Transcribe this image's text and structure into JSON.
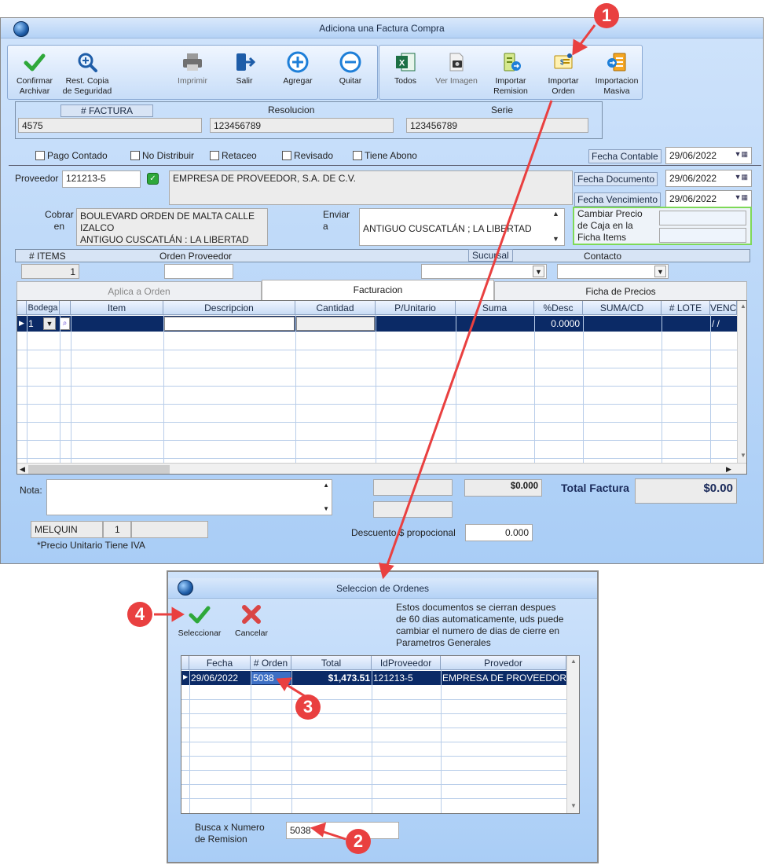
{
  "main_window": {
    "title": "Adiciona una Factura Compra",
    "toolbar": [
      {
        "name": "confirmar",
        "label1": "Confirmar",
        "label2": "Archivar",
        "icon": "check-icon"
      },
      {
        "name": "rest-copia",
        "label1": "Rest. Copia",
        "label2": "de Seguridad",
        "icon": "magnifier-icon"
      },
      {
        "name": "imprimir",
        "label1": "Imprimir",
        "label2": "",
        "icon": "printer-icon"
      },
      {
        "name": "salir",
        "label1": "Salir",
        "label2": "",
        "icon": "exit-icon"
      },
      {
        "name": "agregar",
        "label1": "Agregar",
        "label2": "",
        "icon": "plus-icon"
      },
      {
        "name": "quitar",
        "label1": "Quitar",
        "label2": "",
        "icon": "minus-icon"
      },
      {
        "name": "todos",
        "label1": "Todos",
        "label2": "",
        "icon": "excel-icon"
      },
      {
        "name": "ver-imagen",
        "label1": "Ver Imagen",
        "label2": "",
        "icon": "camera-icon"
      },
      {
        "name": "importar-remision",
        "label1": "Importar",
        "label2": "Remision",
        "icon": "import-remision-icon"
      },
      {
        "name": "importar-orden",
        "label1": "Importar",
        "label2": "Orden",
        "icon": "import-orden-icon"
      },
      {
        "name": "importacion-masiva",
        "label1": "Importacion",
        "label2": "Masiva",
        "icon": "import-masiva-icon"
      }
    ],
    "factura_label": "# FACTURA",
    "factura_value": "4575",
    "resolucion_label": "Resolucion",
    "resolucion_value": "123456789",
    "serie_label": "Serie",
    "serie_value": "123456789",
    "checks": [
      "Pago Contado",
      "No Distribuir",
      "Retaceo",
      "Revisado",
      "Tiene Abono"
    ],
    "fecha_contable_label": "Fecha Contable",
    "fecha_contable": "29/06/2022",
    "proveedor_label": "Proveedor",
    "proveedor_code": "121213-5",
    "proveedor_name": "EMPRESA DE PROVEEDOR, S.A. DE C.V.",
    "fecha_documento_label": "Fecha Documento",
    "fecha_documento": "29/06/2022",
    "fecha_vencimiento_label": "Fecha Vencimiento",
    "fecha_vencimiento": "29/06/2022",
    "cobrar_label1": "Cobrar",
    "cobrar_label2": "en",
    "cobrar_line1": "BOULEVARD ORDEN DE MALTA CALLE",
    "cobrar_line2": "IZALCO",
    "cobrar_line3": "ANTIGUO CUSCATLÁN : LA LIBERTAD",
    "enviar_label1": "Enviar",
    "enviar_label2": "a",
    "enviar_value": "ANTIGUO CUSCATLÁN ; LA LIBERTAD",
    "cambiar_line1": "Cambiar Precio",
    "cambiar_line2": "de Caja en la",
    "cambiar_line3": "Ficha Items",
    "items_label": "# ITEMS",
    "items_value": "1",
    "orden_proveedor_label": "Orden Proveedor",
    "sucursal_label": "Sucursal",
    "contacto_label": "Contacto",
    "tabs": [
      "Aplica a Orden",
      "Facturacion",
      "Ficha de Precios"
    ],
    "grid_headers": [
      "Bodega",
      "Item",
      "Descripcion",
      "Cantidad",
      "P/Unitario",
      "Suma",
      "%Desc",
      "SUMA/CD",
      "# LOTE",
      "VENC"
    ],
    "grid_row": {
      "bodega": "1",
      "desc_pct": "0.0000",
      "venc": "/ /"
    },
    "nota_label": "Nota:",
    "subtotal": "$0.000",
    "total_factura_label": "Total Factura",
    "total_factura": "$0.00",
    "user": "MELQUIN",
    "user_num": "1",
    "precio_note": "*Precio Unitario Tiene IVA",
    "descuento_label": "Descuento $ propocional",
    "descuento_value": "0.000"
  },
  "dialog": {
    "title": "Seleccion de Ordenes",
    "seleccionar": "Seleccionar",
    "cancelar": "Cancelar",
    "info_line1": "Estos documentos se cierran despues",
    "info_line2": "de 60 dias automaticamente, uds puede",
    "info_line3": "cambiar el numero de dias de cierre en",
    "info_line4": "Parametros Generales",
    "headers": [
      "Fecha",
      "# Orden",
      "Total",
      "IdProveedor",
      "Provedor"
    ],
    "row": {
      "fecha": "29/06/2022",
      "orden": "5038",
      "total": "$1,473.51",
      "idprov": "121213-5",
      "prov": "EMPRESA DE PROVEEDOR"
    },
    "busca_line1": "Busca x Numero",
    "busca_line2": "de Remision",
    "busca_value": "5038"
  },
  "callouts": [
    "1",
    "2",
    "3",
    "4"
  ],
  "colors": {
    "accent": "#0b2a66",
    "callout": "#e94040",
    "window_bg": "#bcd6f7"
  }
}
